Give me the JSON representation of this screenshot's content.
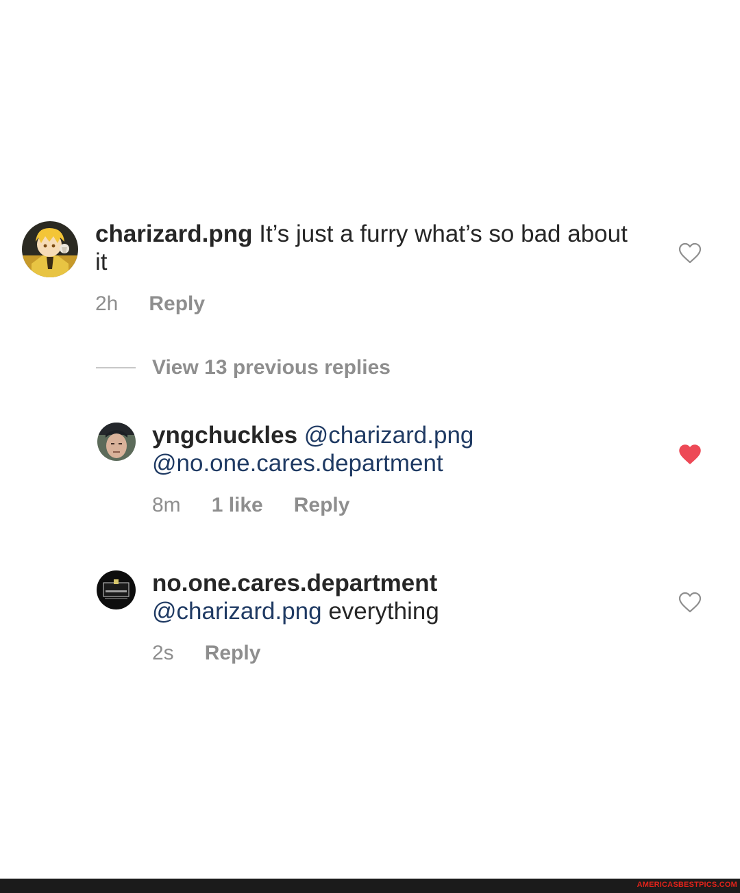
{
  "comments": [
    {
      "username": "charizard.png",
      "text": "It’s just a furry what’s so bad about it",
      "time": "2h",
      "reply_label": "Reply",
      "liked": false
    },
    {
      "username": "yngchuckles",
      "mention_1": "@charizard.png",
      "mention_2": "@no.one.cares.department",
      "time": "8m",
      "likes_label": "1 like",
      "reply_label": "Reply",
      "liked": true
    },
    {
      "username": "no.one.cares.department",
      "mention": "@charizard.png",
      "text": "everything",
      "time": "2s",
      "reply_label": "Reply",
      "liked": false
    }
  ],
  "view_replies_label": "View 13 previous replies",
  "watermark": "AMERICASBESTPICS.COM",
  "icons": {
    "heart_outline": "heart-outline-icon",
    "heart_filled": "heart-filled-icon"
  },
  "colors": {
    "liked_heart": "#ed4956",
    "mention": "#1f3a63",
    "meta_text": "#8e8e8e",
    "watermark": "#e2231a"
  }
}
